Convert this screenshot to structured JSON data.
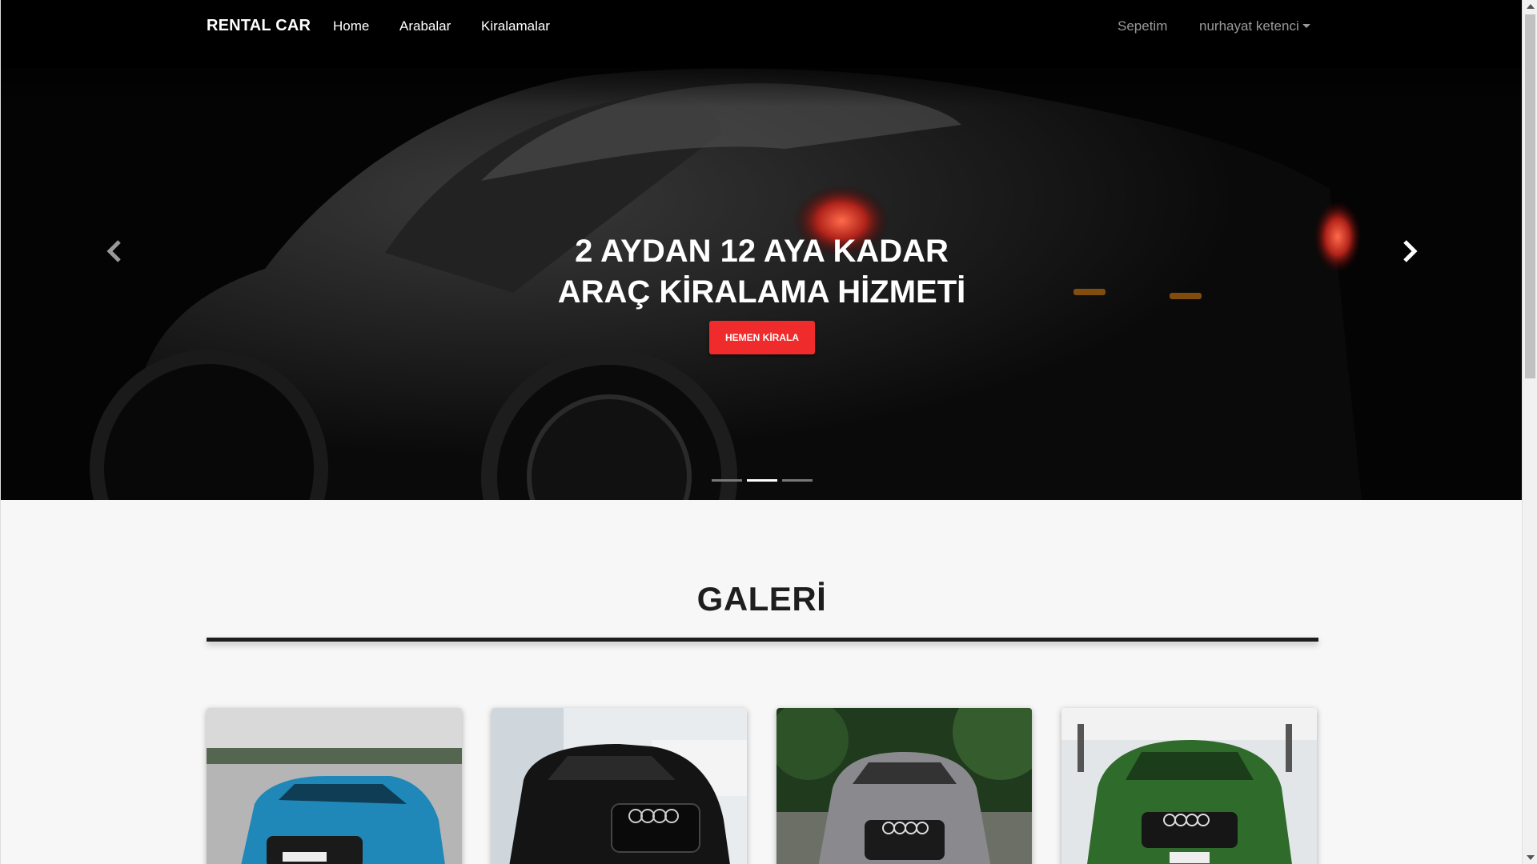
{
  "navbar": {
    "brand": "RENTAL CAR",
    "links": [
      "Home",
      "Arabalar",
      "Kiralamalar"
    ],
    "cart": "Sepetim",
    "user": "nurhayat ketenci"
  },
  "hero": {
    "title_line1": "2 AYDAN 12 AYA KADAR",
    "title_line2": "ARAÇ KİRALAMA HİZMETİ",
    "button": "HEMEN KİRALA",
    "slides_count": 3,
    "active_slide": 2
  },
  "gallery": {
    "title": "GALERİ",
    "cards": [
      {
        "name": "blue-audi-suv",
        "color": "#1f88b8"
      },
      {
        "name": "black-audi-showroom",
        "color": "#141414"
      },
      {
        "name": "gray-audi-sedan",
        "color": "#8a8a8e"
      },
      {
        "name": "green-audi-rs5",
        "color": "#2f6b2b"
      }
    ]
  },
  "colors": {
    "navbar_bg": "#000000",
    "accent_red": "#ef2b2b",
    "page_bg": "#f7f7f7"
  }
}
